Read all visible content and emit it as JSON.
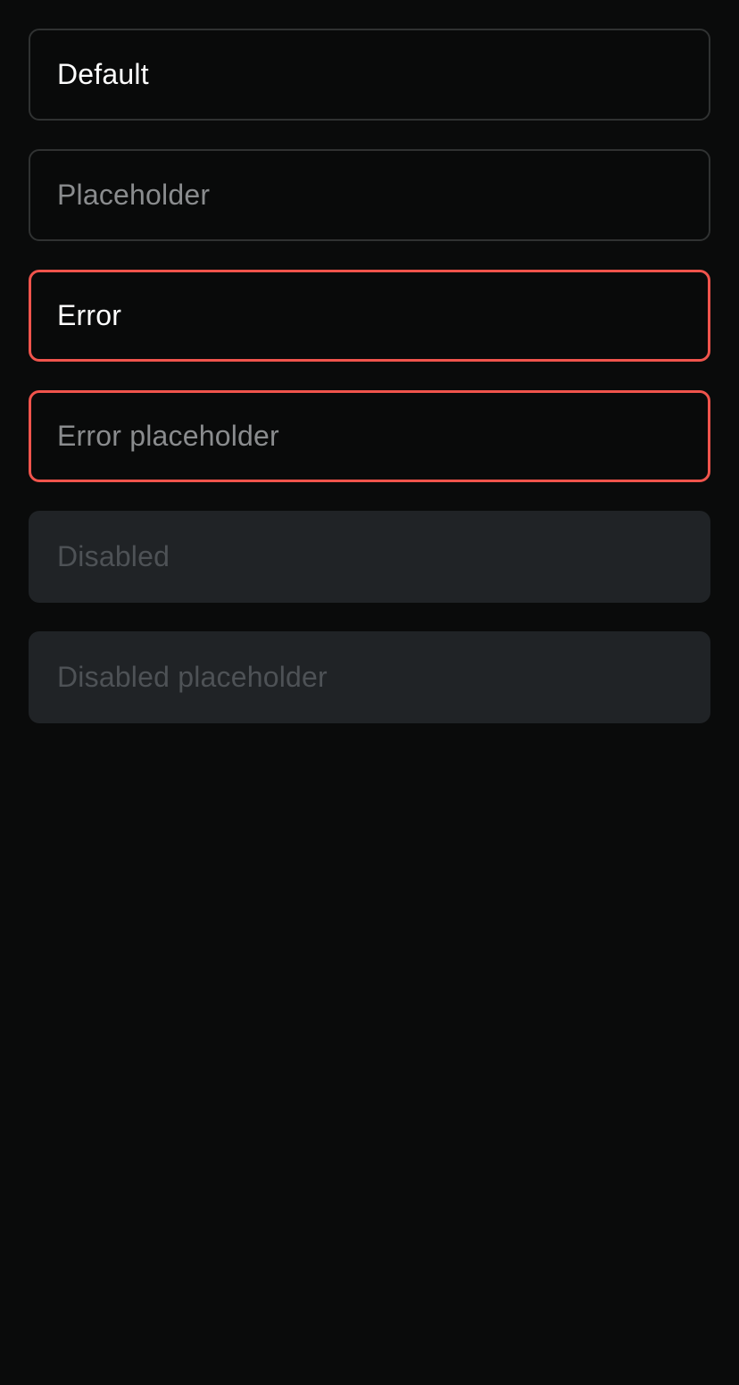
{
  "inputs": [
    {
      "state": "default",
      "value": "Default",
      "placeholder": ""
    },
    {
      "state": "default",
      "value": "",
      "placeholder": "Placeholder"
    },
    {
      "state": "error",
      "value": "Error",
      "placeholder": ""
    },
    {
      "state": "error",
      "value": "",
      "placeholder": "Error placeholder"
    },
    {
      "state": "disabled",
      "value": "Disabled",
      "placeholder": ""
    },
    {
      "state": "disabled",
      "value": "",
      "placeholder": "Disabled placeholder"
    }
  ],
  "colors": {
    "background": "#0a0b0b",
    "border_default": "#303232",
    "border_error": "#f0544c",
    "disabled_fill": "#202326",
    "text_value": "#ffffff",
    "text_placeholder": "#8a8c8e",
    "text_disabled": "#4e5256"
  }
}
